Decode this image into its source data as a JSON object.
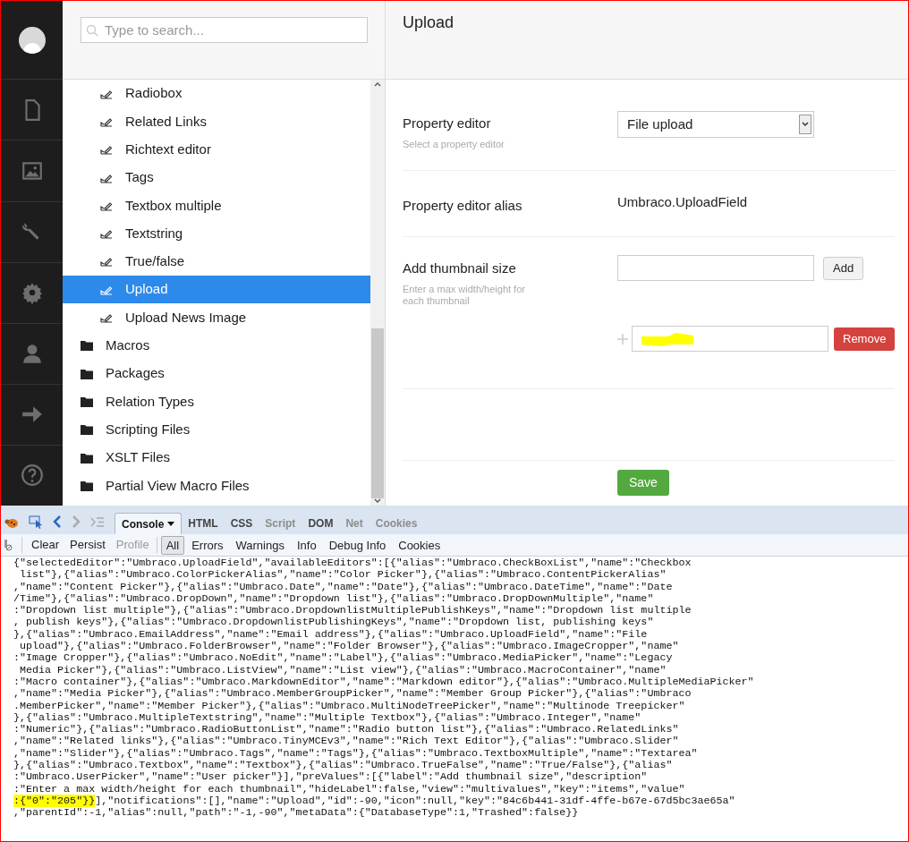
{
  "search": {
    "placeholder": "Type to search..."
  },
  "tree": {
    "items": [
      {
        "kind": "datatype",
        "label": "Radiobox",
        "selected": false
      },
      {
        "kind": "datatype",
        "label": "Related Links",
        "selected": false
      },
      {
        "kind": "datatype",
        "label": "Richtext editor",
        "selected": false
      },
      {
        "kind": "datatype",
        "label": "Tags",
        "selected": false
      },
      {
        "kind": "datatype",
        "label": "Textbox multiple",
        "selected": false
      },
      {
        "kind": "datatype",
        "label": "Textstring",
        "selected": false
      },
      {
        "kind": "datatype",
        "label": "True/false",
        "selected": false
      },
      {
        "kind": "datatype",
        "label": "Upload",
        "selected": true
      },
      {
        "kind": "datatype",
        "label": "Upload News Image",
        "selected": false
      },
      {
        "kind": "folder",
        "label": "Macros",
        "selected": false
      },
      {
        "kind": "folder",
        "label": "Packages",
        "selected": false
      },
      {
        "kind": "folder",
        "label": "Relation Types",
        "selected": false
      },
      {
        "kind": "folder",
        "label": "Scripting Files",
        "selected": false
      },
      {
        "kind": "folder",
        "label": "XSLT Files",
        "selected": false
      },
      {
        "kind": "folder",
        "label": "Partial View Macro Files",
        "selected": false
      }
    ]
  },
  "editor": {
    "title": "Upload",
    "property_editor": {
      "label": "Property editor",
      "description": "Select a property editor",
      "value": "File upload"
    },
    "alias": {
      "label": "Property editor alias",
      "value": "Umbraco.UploadField"
    },
    "thumbnail": {
      "label": "Add thumbnail size",
      "description": "Enter a max width/height for each thumbnail",
      "add_button": "Add",
      "remove_button": "Remove"
    },
    "save_button": "Save"
  },
  "devtools": {
    "tabs": [
      {
        "label": "Console",
        "selected": true,
        "disabled": false
      },
      {
        "label": "HTML",
        "selected": false,
        "disabled": false
      },
      {
        "label": "CSS",
        "selected": false,
        "disabled": false
      },
      {
        "label": "Script",
        "selected": false,
        "disabled": true
      },
      {
        "label": "DOM",
        "selected": false,
        "disabled": false
      },
      {
        "label": "Net",
        "selected": false,
        "disabled": true
      },
      {
        "label": "Cookies",
        "selected": false,
        "disabled": true
      }
    ],
    "actions": [
      {
        "label": "Clear",
        "disabled": false
      },
      {
        "label": "Persist",
        "disabled": false
      },
      {
        "label": "Profile",
        "disabled": true
      }
    ],
    "filters": [
      {
        "label": "All",
        "selected": true
      },
      {
        "label": "Errors",
        "selected": false
      },
      {
        "label": "Warnings",
        "selected": false
      },
      {
        "label": "Info",
        "selected": false
      },
      {
        "label": "Debug Info",
        "selected": false
      },
      {
        "label": "Cookies",
        "selected": false
      }
    ],
    "console_lines": [
      [
        {
          "text": "{\"selectedEditor\":\"Umbraco.UploadField\",\"availableEditors\":[{\"alias\":\"Umbraco.CheckBoxList\",\"name\":\"Checkbox",
          "highlighted": false
        }
      ],
      [
        {
          "text": " list\"},{\"alias\":\"Umbraco.ColorPickerAlias\",\"name\":\"Color Picker\"},{\"alias\":\"Umbraco.ContentPickerAlias\"",
          "highlighted": false
        }
      ],
      [
        {
          "text": ",\"name\":\"Content Picker\"},{\"alias\":\"Umbraco.Date\",\"name\":\"Date\"},{\"alias\":\"Umbraco.DateTime\",\"name\":\"Date",
          "highlighted": false
        }
      ],
      [
        {
          "text": "/Time\"},{\"alias\":\"Umbraco.DropDown\",\"name\":\"Dropdown list\"},{\"alias\":\"Umbraco.DropDownMultiple\",\"name\"",
          "highlighted": false
        }
      ],
      [
        {
          "text": ":\"Dropdown list multiple\"},{\"alias\":\"Umbraco.DropdownlistMultiplePublishKeys\",\"name\":\"Dropdown list multiple",
          "highlighted": false
        }
      ],
      [
        {
          "text": ", publish keys\"},{\"alias\":\"Umbraco.DropdownlistPublishingKeys\",\"name\":\"Dropdown list, publishing keys\"",
          "highlighted": false
        }
      ],
      [
        {
          "text": "},{\"alias\":\"Umbraco.EmailAddress\",\"name\":\"Email address\"},{\"alias\":\"Umbraco.UploadField\",\"name\":\"File",
          "highlighted": false
        }
      ],
      [
        {
          "text": " upload\"},{\"alias\":\"Umbraco.FolderBrowser\",\"name\":\"Folder Browser\"},{\"alias\":\"Umbraco.ImageCropper\",\"name\"",
          "highlighted": false
        }
      ],
      [
        {
          "text": ":\"Image Cropper\"},{\"alias\":\"Umbraco.NoEdit\",\"name\":\"Label\"},{\"alias\":\"Umbraco.MediaPicker\",\"name\":\"Legacy",
          "highlighted": false
        }
      ],
      [
        {
          "text": " Media Picker\"},{\"alias\":\"Umbraco.ListView\",\"name\":\"List view\"},{\"alias\":\"Umbraco.MacroContainer\",\"name\"",
          "highlighted": false
        }
      ],
      [
        {
          "text": ":\"Macro container\"},{\"alias\":\"Umbraco.MarkdownEditor\",\"name\":\"Markdown editor\"},{\"alias\":\"Umbraco.MultipleMediaPicker\"",
          "highlighted": false
        }
      ],
      [
        {
          "text": ",\"name\":\"Media Picker\"},{\"alias\":\"Umbraco.MemberGroupPicker\",\"name\":\"Member Group Picker\"},{\"alias\":\"Umbraco",
          "highlighted": false
        }
      ],
      [
        {
          "text": ".MemberPicker\",\"name\":\"Member Picker\"},{\"alias\":\"Umbraco.MultiNodeTreePicker\",\"name\":\"Multinode Treepicker\"",
          "highlighted": false
        }
      ],
      [
        {
          "text": "},{\"alias\":\"Umbraco.MultipleTextstring\",\"name\":\"Multiple Textbox\"},{\"alias\":\"Umbraco.Integer\",\"name\"",
          "highlighted": false
        }
      ],
      [
        {
          "text": ":\"Numeric\"},{\"alias\":\"Umbraco.RadioButtonList\",\"name\":\"Radio button list\"},{\"alias\":\"Umbraco.RelatedLinks\"",
          "highlighted": false
        }
      ],
      [
        {
          "text": ",\"name\":\"Related links\"},{\"alias\":\"Umbraco.TinyMCEv3\",\"name\":\"Rich Text Editor\"},{\"alias\":\"Umbraco.Slider\"",
          "highlighted": false
        }
      ],
      [
        {
          "text": ",\"name\":\"Slider\"},{\"alias\":\"Umbraco.Tags\",\"name\":\"Tags\"},{\"alias\":\"Umbraco.TextboxMultiple\",\"name\":\"Textarea\"",
          "highlighted": false
        }
      ],
      [
        {
          "text": "},{\"alias\":\"Umbraco.Textbox\",\"name\":\"Textbox\"},{\"alias\":\"Umbraco.TrueFalse\",\"name\":\"True/False\"},{\"alias\"",
          "highlighted": false
        }
      ],
      [
        {
          "text": ":\"Umbraco.UserPicker\",\"name\":\"User picker\"}],\"preValues\":[{\"label\":\"Add thumbnail size\",\"description\"",
          "highlighted": false
        }
      ],
      [
        {
          "text": ":\"Enter a max width/height for each thumbnail\",\"hideLabel\":false,\"view\":\"multivalues\",\"key\":\"items\",\"value\"",
          "highlighted": false
        }
      ],
      [
        {
          "text": ":{\"0\":\"205\"}}",
          "highlighted": true
        },
        {
          "text": "],\"notifications\":[],\"name\":\"Upload\",\"id\":-90,\"icon\":null,\"key\":\"84c6b441-31df-4ffe-b67e-67d5bc3ae65a\"",
          "highlighted": false
        }
      ],
      [
        {
          "text": ",\"parentId\":-1,\"alias\":null,\"path\":\"-1,-90\",\"metaData\":{\"DatabaseType\":1,\"Trashed\":false}}",
          "highlighted": false
        }
      ]
    ]
  }
}
